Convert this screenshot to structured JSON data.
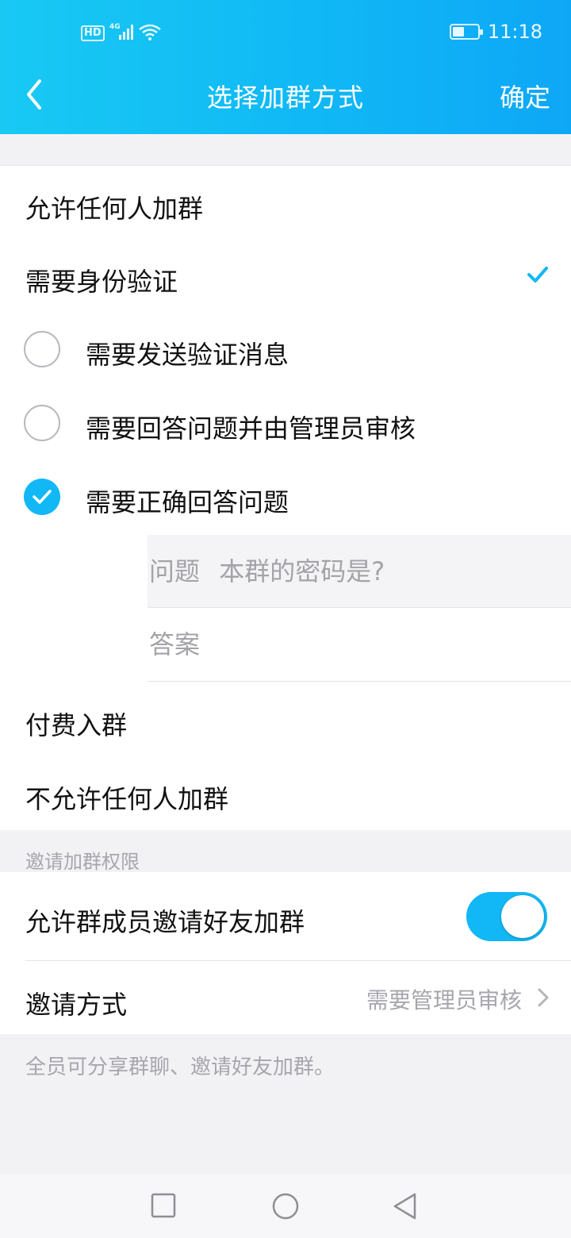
{
  "status_bar": {
    "hd": "HD",
    "network": "4G",
    "time": "11:18",
    "battery_level": 0.35
  },
  "header": {
    "title": "选择加群方式",
    "confirm_label": "确定",
    "back_icon": "chevron-left-icon",
    "accent_color": "#12b7f5"
  },
  "join_options": [
    {
      "label": "允许任何人加群",
      "selected": false
    },
    {
      "label": "需要身份验证",
      "selected": true
    }
  ],
  "verification_options": [
    {
      "label": "需要发送验证消息",
      "checked": false
    },
    {
      "label": "需要回答问题并由管理员审核",
      "checked": false
    },
    {
      "label": "需要正确回答问题",
      "checked": true
    }
  ],
  "question_field": {
    "label": "问题",
    "value": "本群的密码是?"
  },
  "answer_field": {
    "placeholder": "答案"
  },
  "other_options": [
    {
      "label": "付费入群"
    },
    {
      "label": "不允许任何人加群"
    }
  ],
  "invite_section": {
    "header": "邀请加群权限",
    "allow_invite_label": "允许群成员邀请好友加群",
    "allow_invite_on": true,
    "method_label": "邀请方式",
    "method_value": "需要管理员审核",
    "note": "全员可分享群聊、邀请好友加群。"
  }
}
